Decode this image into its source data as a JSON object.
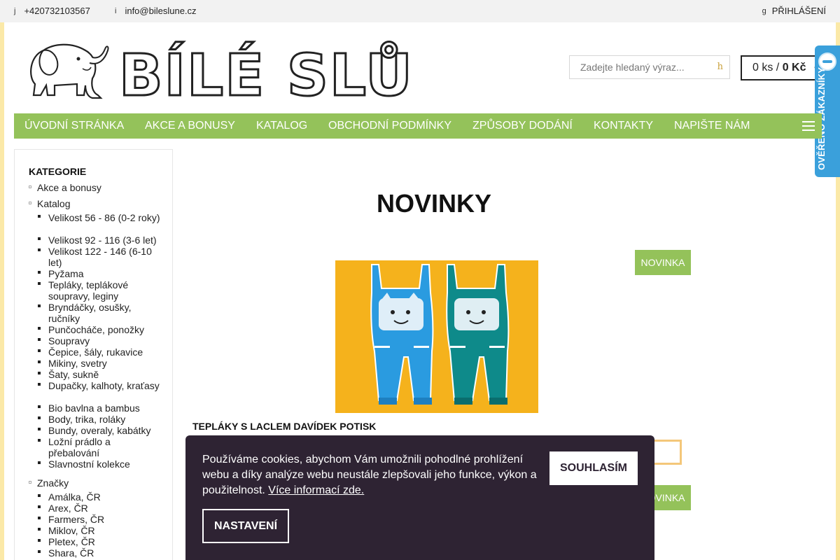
{
  "topbar": {
    "phone_icon": "j",
    "phone": "+420732103567",
    "mail_icon": "i",
    "email": "info@bileslune.cz",
    "login_icon": "g",
    "login": "PŘIHLÁŠENÍ"
  },
  "logo": {
    "text": "BÍLÉ SLŮNĚ",
    "icon": "elephant-logo"
  },
  "search": {
    "placeholder": "Zadejte hledaný výraz...",
    "icon": "h"
  },
  "cart": {
    "count": "0 ks",
    "separator": "/",
    "total": "0 Kč",
    "icon": "cart-icon"
  },
  "verified_badge": {
    "text": "OVĚŘENO ZÁKAZNÍKY"
  },
  "nav": {
    "items": [
      "ÚVODNÍ STRÁNKA",
      "AKCE A BONUSY",
      "KATALOG",
      "OBCHODNÍ PODMÍNKY",
      "ZPŮSOBY DODÁNÍ",
      "KONTAKTY",
      "NAPIŠTE NÁM"
    ],
    "menu_icon": "hamburger-icon"
  },
  "sidebar": {
    "title": "KATEGORIE",
    "categories": [
      "Akce a bonusy",
      "Katalog",
      "Značky"
    ],
    "katalog_items": [
      "Velikost 56 - 86 (0-2 roky)",
      "Velikost 92 - 116 (3-6 let)",
      "Velikost 122 - 146 (6-10 let)",
      "Pyžama",
      "Tepláky, teplákové soupravy, leginy",
      "Bryndáčky, osušky, ručníky",
      "Punčocháče, ponožky",
      "Soupravy",
      "Čepice, šály, rukavice",
      "Mikiny, svetry",
      "Šaty, sukně",
      "Dupačky, kalhoty, kraťasy",
      "Bio bavlna a bambus",
      "Body, trika, roláky",
      "Bundy, overaly, kabátky",
      "Ložní prádlo a přebalování",
      "Slavnostní kolekce"
    ],
    "brand_items": [
      "Amálka, ČR",
      "Arex, ČR",
      "Farmers, ČR",
      "Miklov, ČR",
      "Pletex, ČR",
      "Shara, ČR"
    ]
  },
  "main": {
    "title": "NOVINKY",
    "badge": "NOVINKA",
    "product_name": "TEPLÁKY S LACLEM DAVÍDEK POTISK",
    "badge2": "NOVINKA"
  },
  "cookie": {
    "text": "Používáme cookies, abychom Vám umožnili pohodlné prohlížení webu a díky analýze webu neustále zlepšovali jeho funkce, výkon a použitelnost.",
    "link": "Více informací zde.",
    "agree": "SOUHLASÍM",
    "settings": "NASTAVENÍ"
  },
  "colors": {
    "nav_green": "#94c25a",
    "cookie_bg": "#2e2333",
    "badge_blue": "#3aa0db",
    "product_bg": "#f5b21c"
  }
}
